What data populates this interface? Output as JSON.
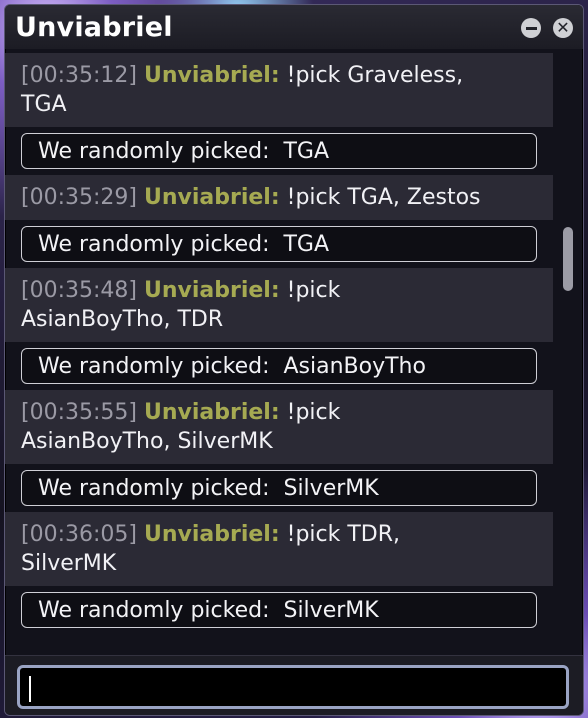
{
  "window": {
    "title": "Unviabriel"
  },
  "messages": [
    {
      "timestamp": "[00:35:12]",
      "user": "Unviabriel:",
      "line1": "!pick Graveless,",
      "line2": "TGA",
      "result_label": "We randomly picked:",
      "result_value": "TGA"
    },
    {
      "timestamp": "[00:35:29]",
      "user": "Unviabriel:",
      "line1": "!pick TGA, Zestos",
      "line2": "",
      "result_label": "We randomly picked:",
      "result_value": "TGA"
    },
    {
      "timestamp": "[00:35:48]",
      "user": "Unviabriel:",
      "line1": "!pick",
      "line2": "AsianBoyTho, TDR",
      "result_label": "We randomly picked:",
      "result_value": "AsianBoyTho"
    },
    {
      "timestamp": "[00:35:55]",
      "user": "Unviabriel:",
      "line1": "!pick",
      "line2": "AsianBoyTho, SilverMK",
      "result_label": "We randomly picked:",
      "result_value": "SilverMK"
    },
    {
      "timestamp": "[00:36:05]",
      "user": "Unviabriel:",
      "line1": "!pick TDR,",
      "line2": "SilverMK",
      "result_label": "We randomly picked:",
      "result_value": "SilverMK"
    }
  ],
  "input": {
    "value": "",
    "placeholder": ""
  },
  "colors": {
    "username": "#a6aa52",
    "timestamp": "#9b9aa5",
    "message_bg": "#2b2a35"
  }
}
